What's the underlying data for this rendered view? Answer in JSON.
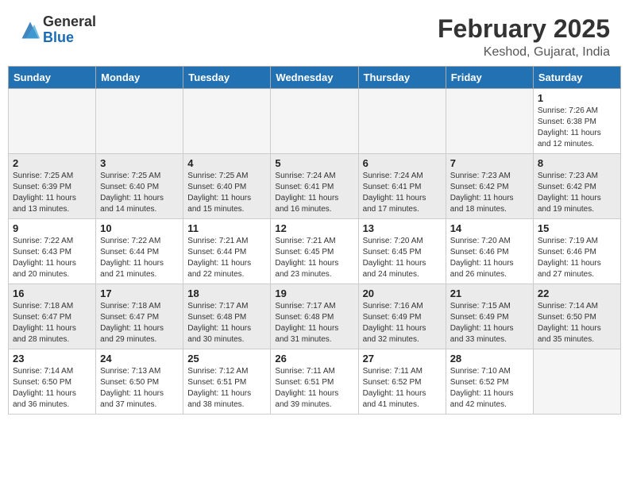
{
  "header": {
    "logo_general": "General",
    "logo_blue": "Blue",
    "title": "February 2025",
    "subtitle": "Keshod, Gujarat, India"
  },
  "days_of_week": [
    "Sunday",
    "Monday",
    "Tuesday",
    "Wednesday",
    "Thursday",
    "Friday",
    "Saturday"
  ],
  "weeks": [
    [
      {
        "day": "",
        "info": "",
        "empty": true
      },
      {
        "day": "",
        "info": "",
        "empty": true
      },
      {
        "day": "",
        "info": "",
        "empty": true
      },
      {
        "day": "",
        "info": "",
        "empty": true
      },
      {
        "day": "",
        "info": "",
        "empty": true
      },
      {
        "day": "",
        "info": "",
        "empty": true
      },
      {
        "day": "1",
        "info": "Sunrise: 7:26 AM\nSunset: 6:38 PM\nDaylight: 11 hours\nand 12 minutes."
      }
    ],
    [
      {
        "day": "2",
        "info": "Sunrise: 7:25 AM\nSunset: 6:39 PM\nDaylight: 11 hours\nand 13 minutes."
      },
      {
        "day": "3",
        "info": "Sunrise: 7:25 AM\nSunset: 6:40 PM\nDaylight: 11 hours\nand 14 minutes."
      },
      {
        "day": "4",
        "info": "Sunrise: 7:25 AM\nSunset: 6:40 PM\nDaylight: 11 hours\nand 15 minutes."
      },
      {
        "day": "5",
        "info": "Sunrise: 7:24 AM\nSunset: 6:41 PM\nDaylight: 11 hours\nand 16 minutes."
      },
      {
        "day": "6",
        "info": "Sunrise: 7:24 AM\nSunset: 6:41 PM\nDaylight: 11 hours\nand 17 minutes."
      },
      {
        "day": "7",
        "info": "Sunrise: 7:23 AM\nSunset: 6:42 PM\nDaylight: 11 hours\nand 18 minutes."
      },
      {
        "day": "8",
        "info": "Sunrise: 7:23 AM\nSunset: 6:42 PM\nDaylight: 11 hours\nand 19 minutes."
      }
    ],
    [
      {
        "day": "9",
        "info": "Sunrise: 7:22 AM\nSunset: 6:43 PM\nDaylight: 11 hours\nand 20 minutes."
      },
      {
        "day": "10",
        "info": "Sunrise: 7:22 AM\nSunset: 6:44 PM\nDaylight: 11 hours\nand 21 minutes."
      },
      {
        "day": "11",
        "info": "Sunrise: 7:21 AM\nSunset: 6:44 PM\nDaylight: 11 hours\nand 22 minutes."
      },
      {
        "day": "12",
        "info": "Sunrise: 7:21 AM\nSunset: 6:45 PM\nDaylight: 11 hours\nand 23 minutes."
      },
      {
        "day": "13",
        "info": "Sunrise: 7:20 AM\nSunset: 6:45 PM\nDaylight: 11 hours\nand 24 minutes."
      },
      {
        "day": "14",
        "info": "Sunrise: 7:20 AM\nSunset: 6:46 PM\nDaylight: 11 hours\nand 26 minutes."
      },
      {
        "day": "15",
        "info": "Sunrise: 7:19 AM\nSunset: 6:46 PM\nDaylight: 11 hours\nand 27 minutes."
      }
    ],
    [
      {
        "day": "16",
        "info": "Sunrise: 7:18 AM\nSunset: 6:47 PM\nDaylight: 11 hours\nand 28 minutes."
      },
      {
        "day": "17",
        "info": "Sunrise: 7:18 AM\nSunset: 6:47 PM\nDaylight: 11 hours\nand 29 minutes."
      },
      {
        "day": "18",
        "info": "Sunrise: 7:17 AM\nSunset: 6:48 PM\nDaylight: 11 hours\nand 30 minutes."
      },
      {
        "day": "19",
        "info": "Sunrise: 7:17 AM\nSunset: 6:48 PM\nDaylight: 11 hours\nand 31 minutes."
      },
      {
        "day": "20",
        "info": "Sunrise: 7:16 AM\nSunset: 6:49 PM\nDaylight: 11 hours\nand 32 minutes."
      },
      {
        "day": "21",
        "info": "Sunrise: 7:15 AM\nSunset: 6:49 PM\nDaylight: 11 hours\nand 33 minutes."
      },
      {
        "day": "22",
        "info": "Sunrise: 7:14 AM\nSunset: 6:50 PM\nDaylight: 11 hours\nand 35 minutes."
      }
    ],
    [
      {
        "day": "23",
        "info": "Sunrise: 7:14 AM\nSunset: 6:50 PM\nDaylight: 11 hours\nand 36 minutes."
      },
      {
        "day": "24",
        "info": "Sunrise: 7:13 AM\nSunset: 6:50 PM\nDaylight: 11 hours\nand 37 minutes."
      },
      {
        "day": "25",
        "info": "Sunrise: 7:12 AM\nSunset: 6:51 PM\nDaylight: 11 hours\nand 38 minutes."
      },
      {
        "day": "26",
        "info": "Sunrise: 7:11 AM\nSunset: 6:51 PM\nDaylight: 11 hours\nand 39 minutes."
      },
      {
        "day": "27",
        "info": "Sunrise: 7:11 AM\nSunset: 6:52 PM\nDaylight: 11 hours\nand 41 minutes."
      },
      {
        "day": "28",
        "info": "Sunrise: 7:10 AM\nSunset: 6:52 PM\nDaylight: 11 hours\nand 42 minutes."
      },
      {
        "day": "",
        "info": "",
        "empty": true
      }
    ]
  ]
}
